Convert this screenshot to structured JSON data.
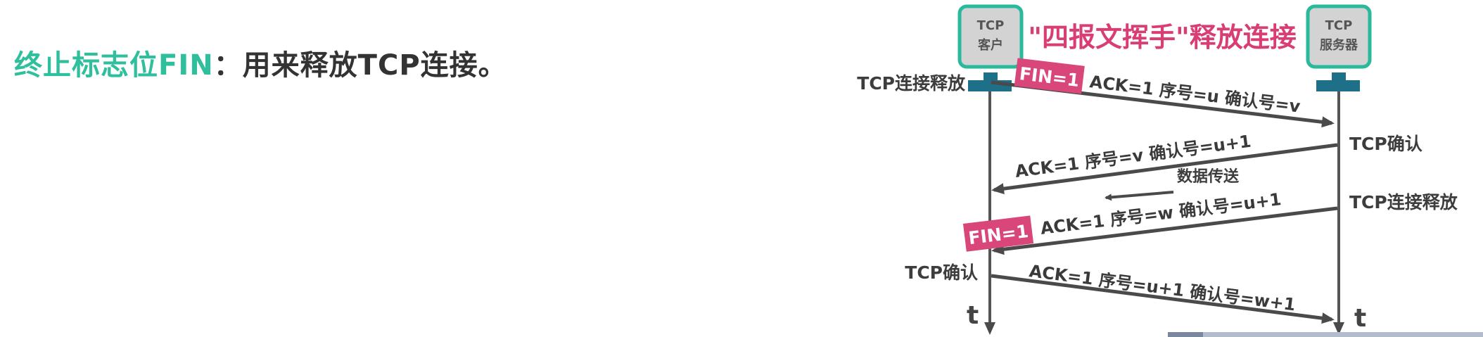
{
  "heading": {
    "highlight": "终止标志位FIN",
    "rest": "：用来释放TCP连接。"
  },
  "diagram": {
    "title": "\"四报文挥手\"释放连接",
    "client": {
      "line1": "TCP",
      "line2": "客户"
    },
    "server": {
      "line1": "TCP",
      "line2": "服务器"
    },
    "messages": [
      {
        "flag": "FIN=1",
        "text": "ACK=1  序号=u  确认号=v"
      },
      {
        "text": "ACK=1  序号=v  确认号=u+1"
      },
      {
        "text": "数据传送"
      },
      {
        "flag": "FIN=1",
        "text": "ACK=1  序号=w  确认号=u+1"
      },
      {
        "text": "ACK=1  序号=u+1  确认号=w+1"
      }
    ],
    "states": {
      "client_release": "TCP连接释放",
      "server_ack": "TCP确认",
      "server_release": "TCP连接释放",
      "client_ack": "TCP确认"
    },
    "time_label": "t",
    "colors": {
      "accent": "#2fbf9c",
      "flag": "#d9467a",
      "node": "#1e6f88"
    }
  }
}
